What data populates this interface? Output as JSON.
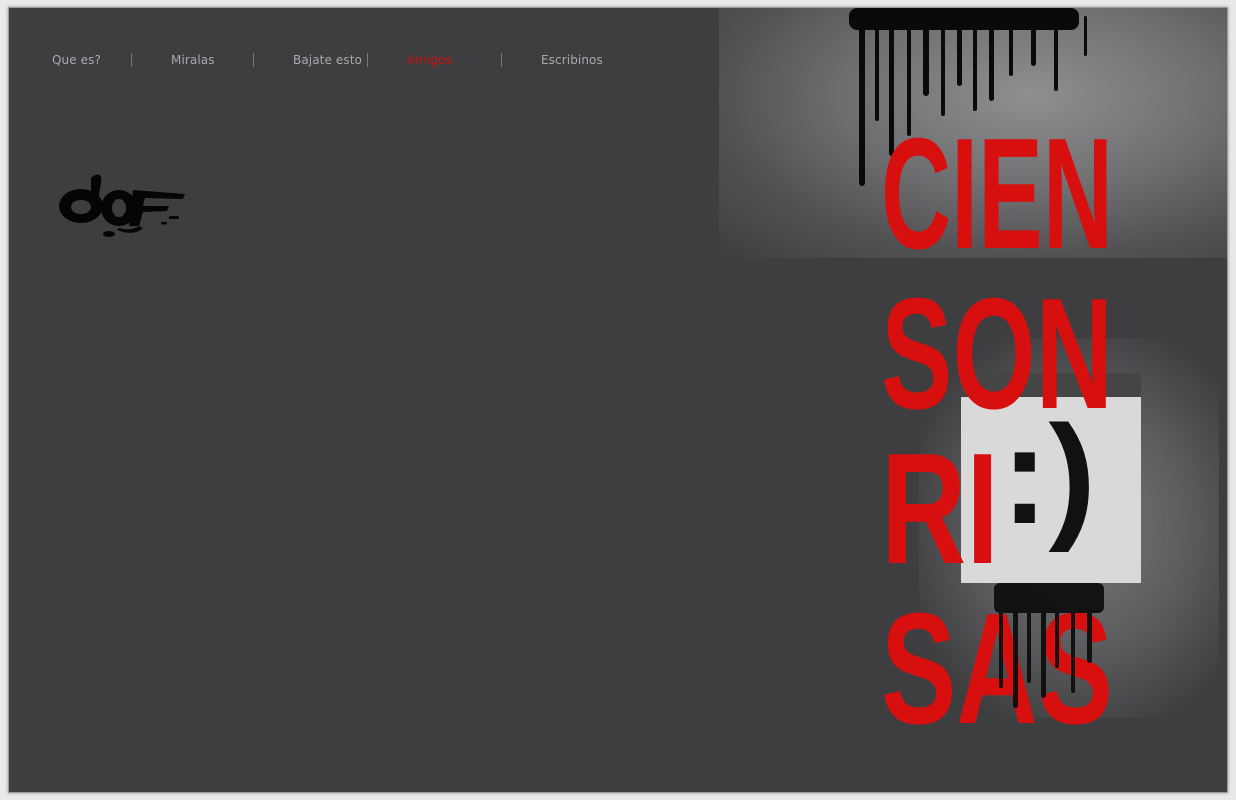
{
  "nav": {
    "items": [
      {
        "label": "Que es?",
        "active": false
      },
      {
        "label": "Miralas",
        "active": false
      },
      {
        "label": "Bajate esto",
        "active": false
      },
      {
        "label": "Amigos",
        "active": true
      },
      {
        "label": "Escribinos",
        "active": false
      }
    ]
  },
  "artwork": {
    "lines": [
      "CIEN",
      "SON",
      "RI",
      "SAS"
    ],
    "smiley": ":)"
  },
  "colors": {
    "background": "#3e3e41",
    "accent": "#cf1010",
    "nav_text": "#a9a9ad"
  }
}
